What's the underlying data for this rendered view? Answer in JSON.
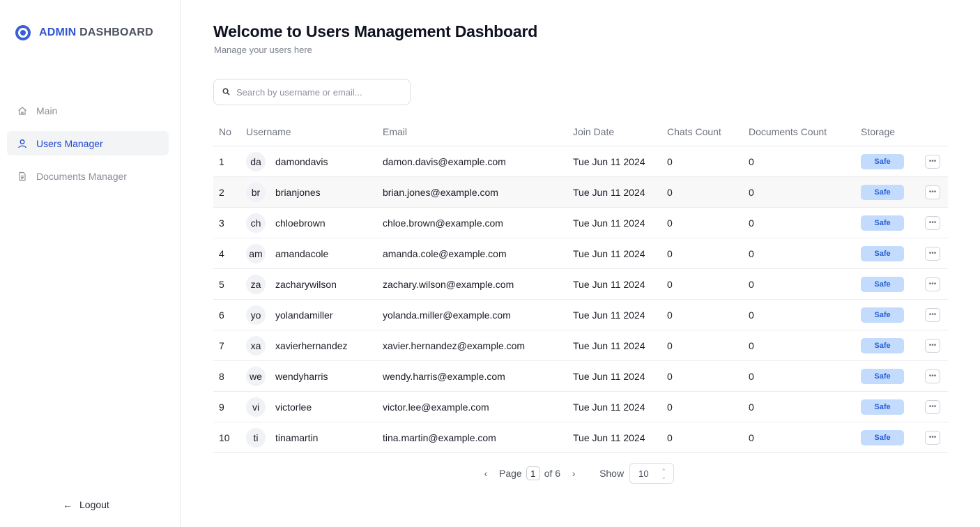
{
  "sidebar": {
    "brand_bold": "ADMIN",
    "brand_rest": "DASHBOARD",
    "items": [
      {
        "label": "Main",
        "icon": "home-icon"
      },
      {
        "label": "Users Manager",
        "icon": "user-icon"
      },
      {
        "label": "Documents Manager",
        "icon": "document-icon"
      }
    ],
    "logout_label": "Logout"
  },
  "header": {
    "title": "Welcome to Users Management Dashboard",
    "subtitle": "Manage your users here"
  },
  "search": {
    "placeholder": "Search by username or email...",
    "value": ""
  },
  "table": {
    "columns": {
      "no": "No",
      "username": "Username",
      "email": "Email",
      "join_date": "Join Date",
      "chats": "Chats Count",
      "documents": "Documents Count",
      "storage": "Storage"
    },
    "rows": [
      {
        "no": "1",
        "initials": "da",
        "username": "damondavis",
        "email": "damon.davis@example.com",
        "date": "Tue Jun 11 2024",
        "chats": "0",
        "docs": "0",
        "storage": "Safe"
      },
      {
        "no": "2",
        "initials": "br",
        "username": "brianjones",
        "email": "brian.jones@example.com",
        "date": "Tue Jun 11 2024",
        "chats": "0",
        "docs": "0",
        "storage": "Safe"
      },
      {
        "no": "3",
        "initials": "ch",
        "username": "chloebrown",
        "email": "chloe.brown@example.com",
        "date": "Tue Jun 11 2024",
        "chats": "0",
        "docs": "0",
        "storage": "Safe"
      },
      {
        "no": "4",
        "initials": "am",
        "username": "amandacole",
        "email": "amanda.cole@example.com",
        "date": "Tue Jun 11 2024",
        "chats": "0",
        "docs": "0",
        "storage": "Safe"
      },
      {
        "no": "5",
        "initials": "za",
        "username": "zacharywilson",
        "email": "zachary.wilson@example.com",
        "date": "Tue Jun 11 2024",
        "chats": "0",
        "docs": "0",
        "storage": "Safe"
      },
      {
        "no": "6",
        "initials": "yo",
        "username": "yolandamiller",
        "email": "yolanda.miller@example.com",
        "date": "Tue Jun 11 2024",
        "chats": "0",
        "docs": "0",
        "storage": "Safe"
      },
      {
        "no": "7",
        "initials": "xa",
        "username": "xavierhernandez",
        "email": "xavier.hernandez@example.com",
        "date": "Tue Jun 11 2024",
        "chats": "0",
        "docs": "0",
        "storage": "Safe"
      },
      {
        "no": "8",
        "initials": "we",
        "username": "wendyharris",
        "email": "wendy.harris@example.com",
        "date": "Tue Jun 11 2024",
        "chats": "0",
        "docs": "0",
        "storage": "Safe"
      },
      {
        "no": "9",
        "initials": "vi",
        "username": "victorlee",
        "email": "victor.lee@example.com",
        "date": "Tue Jun 11 2024",
        "chats": "0",
        "docs": "0",
        "storage": "Safe"
      },
      {
        "no": "10",
        "initials": "ti",
        "username": "tinamartin",
        "email": "tina.martin@example.com",
        "date": "Tue Jun 11 2024",
        "chats": "0",
        "docs": "0",
        "storage": "Safe"
      }
    ]
  },
  "pagination": {
    "prev": "‹",
    "page_label": "Page",
    "current_page": "1",
    "of_label": "of 6",
    "next": "›",
    "show_label": "Show",
    "page_size": "10"
  },
  "colors": {
    "accent": "#2f55d4",
    "badge_bg": "#c3dcfd",
    "badge_text": "#2b5fd3"
  }
}
